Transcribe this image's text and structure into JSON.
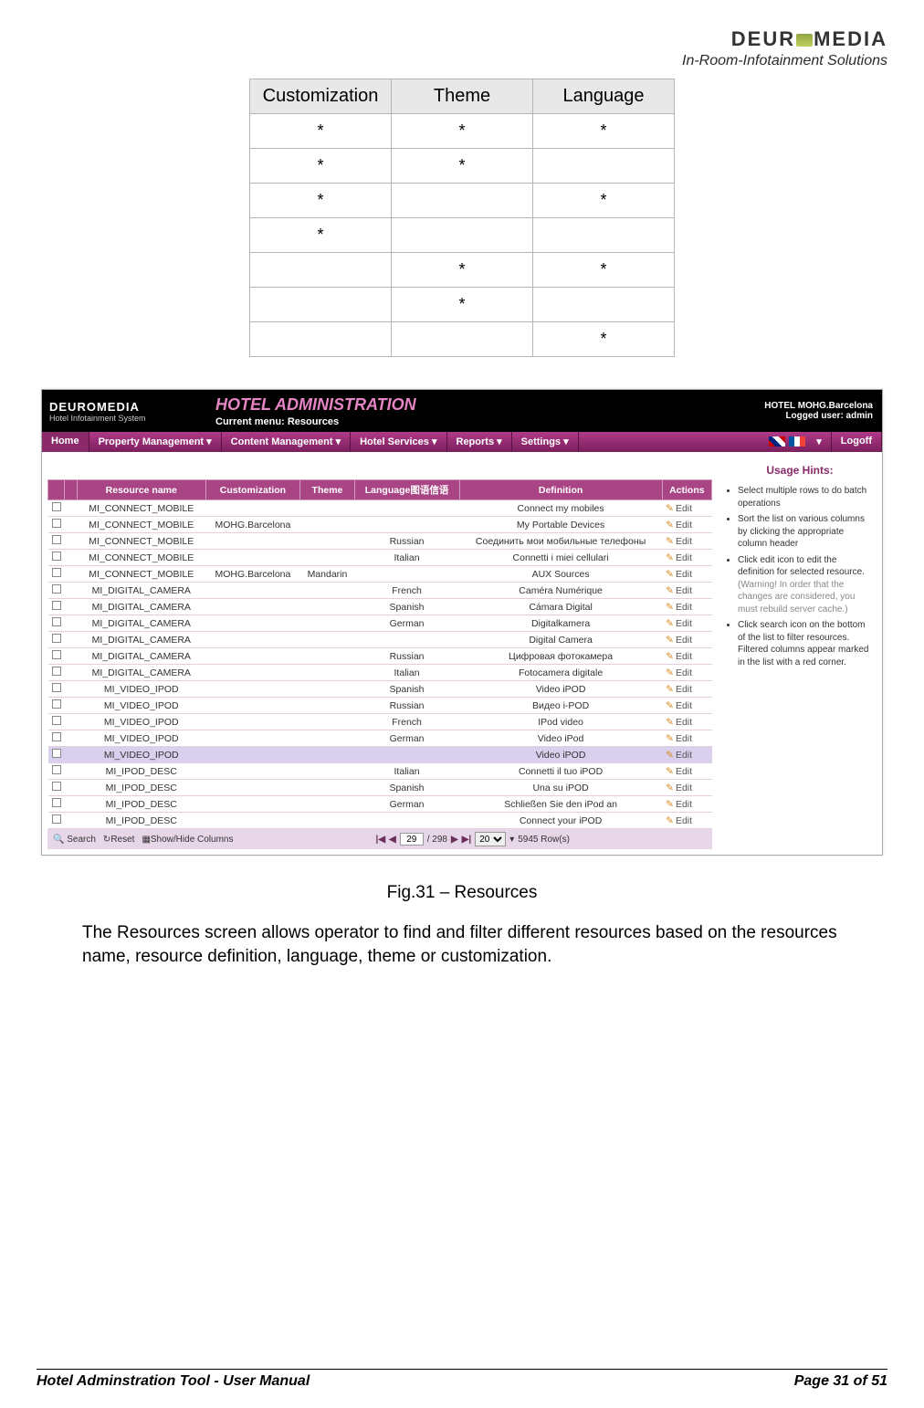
{
  "logo": {
    "brand_pre": "DEUR",
    "brand_post": "MEDIA",
    "tagline": "In-Room-Infotainment Solutions"
  },
  "star_table": {
    "headers": [
      "Customization",
      "Theme",
      "Language"
    ],
    "rows": [
      [
        "*",
        "*",
        "*"
      ],
      [
        "*",
        "*",
        ""
      ],
      [
        "*",
        "",
        "*"
      ],
      [
        "*",
        "",
        ""
      ],
      [
        "",
        "*",
        "*"
      ],
      [
        "",
        "*",
        ""
      ],
      [
        "",
        "",
        "*"
      ]
    ]
  },
  "screenshot": {
    "logo": "DEUROMEDIA",
    "logo_sub": "Hotel Infotainment System",
    "title": "HOTEL ADMINISTRATION",
    "subtitle": "Current menu: Resources",
    "hotel_line": "HOTEL MOHG.Barcelona",
    "user_line": "Logged user: admin",
    "nav": [
      "Home",
      "Property Management",
      "Content Management",
      "Hotel Services",
      "Reports",
      "Settings"
    ],
    "logoff": "Logoff",
    "columns": [
      "",
      "",
      "Resource name",
      "Customization",
      "Theme",
      "Language图语信语",
      "Definition",
      "Actions"
    ],
    "rows": [
      {
        "name": "MI_CONNECT_MOBILE",
        "cust": "",
        "theme": "",
        "lang": "",
        "def": "Connect my mobiles"
      },
      {
        "name": "MI_CONNECT_MOBILE",
        "cust": "MOHG.Barcelona",
        "theme": "",
        "lang": "",
        "def": "My Portable Devices"
      },
      {
        "name": "MI_CONNECT_MOBILE",
        "cust": "",
        "theme": "",
        "lang": "Russian",
        "def": "Соединить мои мобильные телефоны"
      },
      {
        "name": "MI_CONNECT_MOBILE",
        "cust": "",
        "theme": "",
        "lang": "Italian",
        "def": "Connetti i miei cellulari"
      },
      {
        "name": "MI_CONNECT_MOBILE",
        "cust": "MOHG.Barcelona",
        "theme": "Mandarin",
        "lang": "",
        "def": "AUX Sources"
      },
      {
        "name": "MI_DIGITAL_CAMERA",
        "cust": "",
        "theme": "",
        "lang": "French",
        "def": "Caméra Numérique"
      },
      {
        "name": "MI_DIGITAL_CAMERA",
        "cust": "",
        "theme": "",
        "lang": "Spanish",
        "def": "Cámara Digital"
      },
      {
        "name": "MI_DIGITAL_CAMERA",
        "cust": "",
        "theme": "",
        "lang": "German",
        "def": "Digitalkamera"
      },
      {
        "name": "MI_DIGITAL_CAMERA",
        "cust": "",
        "theme": "",
        "lang": "",
        "def": "Digital Camera"
      },
      {
        "name": "MI_DIGITAL_CAMERA",
        "cust": "",
        "theme": "",
        "lang": "Russian",
        "def": "Цифровая фотокамера"
      },
      {
        "name": "MI_DIGITAL_CAMERA",
        "cust": "",
        "theme": "",
        "lang": "Italian",
        "def": "Fotocamera digitale"
      },
      {
        "name": "MI_VIDEO_IPOD",
        "cust": "",
        "theme": "",
        "lang": "Spanish",
        "def": "Video iPOD"
      },
      {
        "name": "MI_VIDEO_IPOD",
        "cust": "",
        "theme": "",
        "lang": "Russian",
        "def": "Видео i-POD"
      },
      {
        "name": "MI_VIDEO_IPOD",
        "cust": "",
        "theme": "",
        "lang": "French",
        "def": "IPod video"
      },
      {
        "name": "MI_VIDEO_IPOD",
        "cust": "",
        "theme": "",
        "lang": "German",
        "def": "Video iPod"
      },
      {
        "name": "MI_VIDEO_IPOD",
        "cust": "",
        "theme": "",
        "lang": "",
        "def": "Video iPOD",
        "sel": true
      },
      {
        "name": "MI_IPOD_DESC",
        "cust": "",
        "theme": "",
        "lang": "Italian",
        "def": "Connetti il tuo iPOD"
      },
      {
        "name": "MI_IPOD_DESC",
        "cust": "",
        "theme": "",
        "lang": "Spanish",
        "def": "Una su iPOD"
      },
      {
        "name": "MI_IPOD_DESC",
        "cust": "",
        "theme": "",
        "lang": "German",
        "def": "Schließen Sie den iPod an"
      },
      {
        "name": "MI_IPOD_DESC",
        "cust": "",
        "theme": "",
        "lang": "",
        "def": "Connect your iPOD"
      }
    ],
    "edit_label": "Edit",
    "pager": {
      "search": "Search",
      "reset": "Reset",
      "showhide": "Show/Hide Columns",
      "page": "29",
      "total_pages": "/ 298",
      "page_size": "20",
      "rows_label": "5945 Row(s)"
    },
    "hints_title": "Usage Hints:",
    "hints": [
      "Select multiple rows to do batch operations",
      "Sort the list on various columns by clicking the appropriate column header",
      "Click edit icon to edit the definition for selected resource.",
      "Click search icon on the bottom of the list to filter resources. Filtered columns appear marked in the list with a red corner."
    ],
    "warning": "(Warning! In order that the changes are considered, you must rebuild server cache.)"
  },
  "caption": "Fig.31 – Resources",
  "bodytext": "The Resources screen allows operator to find and filter different resources based on the resources name, resource definition, language, theme or customization.",
  "footer": {
    "left": "Hotel Adminstration Tool - User Manual",
    "right": "Page 31 of 51"
  }
}
